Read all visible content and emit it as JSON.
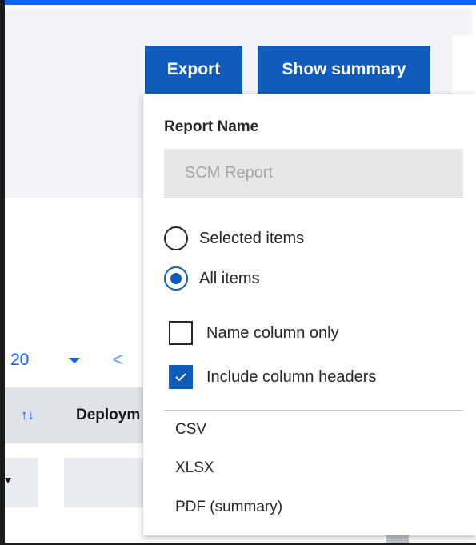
{
  "toolbar": {
    "export_label": "Export",
    "summary_label": "Show summary"
  },
  "pagination": {
    "page_size": "20",
    "prev_glyph": "<"
  },
  "table": {
    "sort_glyph": "↑↓",
    "columns": [
      "Deploym"
    ]
  },
  "export_panel": {
    "report_name_label": "Report Name",
    "report_name_value": "",
    "report_name_placeholder": "SCM Report",
    "scope_options": [
      {
        "label": "Selected items",
        "selected": false
      },
      {
        "label": "All items",
        "selected": true
      }
    ],
    "name_column_only": {
      "label": "Name column only",
      "checked": false
    },
    "include_headers": {
      "label": "Include column headers",
      "checked": true
    },
    "formats": [
      "CSV",
      "XLSX",
      "PDF (summary)"
    ]
  },
  "colors": {
    "primary": "#0f5cba",
    "link": "#0f62fe",
    "background_band": "#f1f3f6"
  }
}
